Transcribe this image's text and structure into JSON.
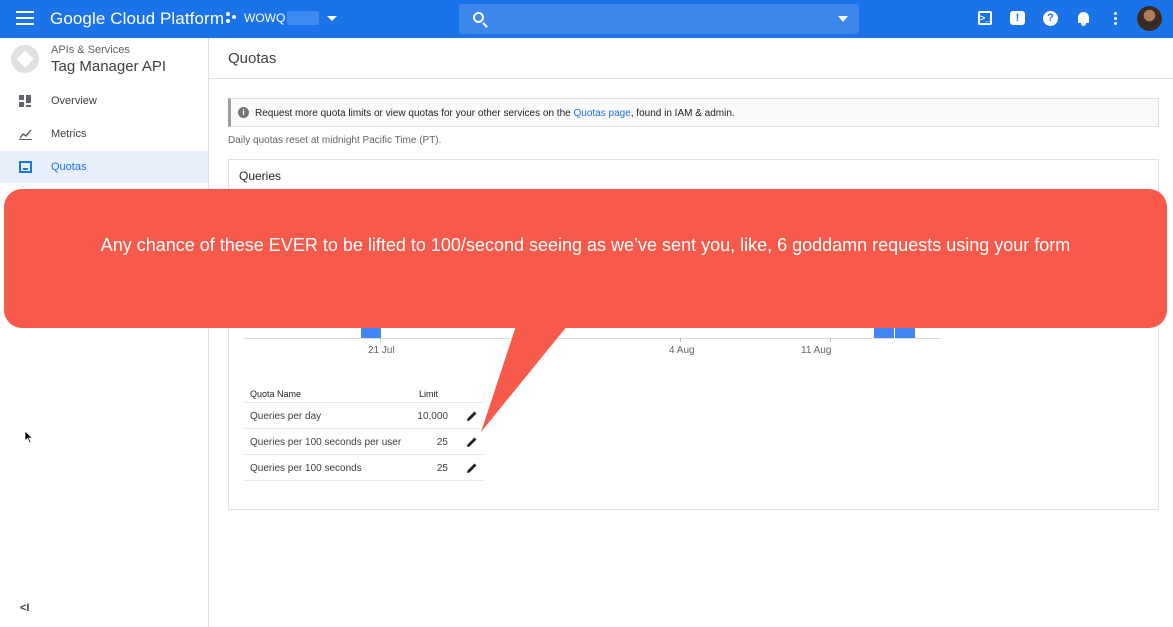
{
  "header": {
    "brand": "Google Cloud Platform",
    "project_name": "WOWQ",
    "search_placeholder": "",
    "icons": [
      "menu-icon",
      "project-icon",
      "search-icon",
      "cloud-shell-icon",
      "feedback-icon",
      "help-icon",
      "notifications-icon",
      "more-vert-icon",
      "avatar"
    ]
  },
  "sidebar": {
    "api_category": "APIs & Services",
    "api_name": "Tag Manager API",
    "items": [
      {
        "label": "Overview",
        "icon": "overview-icon"
      },
      {
        "label": "Metrics",
        "icon": "metrics-icon"
      },
      {
        "label": "Quotas",
        "icon": "quotas-icon",
        "active": true
      }
    ],
    "collapse_label": "<I"
  },
  "main": {
    "page_title": "Quotas",
    "info_banner": {
      "text_before": "Request more quota limits or view quotas for your other services on the ",
      "link": "Quotas page",
      "text_after": ", found in IAM & admin."
    },
    "reset_note": "Daily quotas reset at midnight Pacific Time (PT).",
    "card_title": "Queries",
    "table": {
      "columns": [
        "Quota Name",
        "Limit"
      ],
      "rows": [
        {
          "name": "Queries per day",
          "limit": "10,000"
        },
        {
          "name": "Queries per 100 seconds per user",
          "limit": "25"
        },
        {
          "name": "Queries per 100 seconds",
          "limit": "25"
        }
      ]
    }
  },
  "chart_data": {
    "type": "bar",
    "x_tick_labels": [
      "21 Jul",
      "4 Aug",
      "11 Aug"
    ],
    "title": "",
    "xlabel": "",
    "ylabel": ""
  },
  "callout": {
    "text": "Any chance of these EVER to be lifted to 100/second seeing as we’ve sent you, like, 6 goddamn requests using your form"
  },
  "colors": {
    "header_bg": "#1a73e8",
    "accent": "#1a73e8",
    "bar": "#4285f4",
    "callout_bg": "#f75a4b"
  }
}
